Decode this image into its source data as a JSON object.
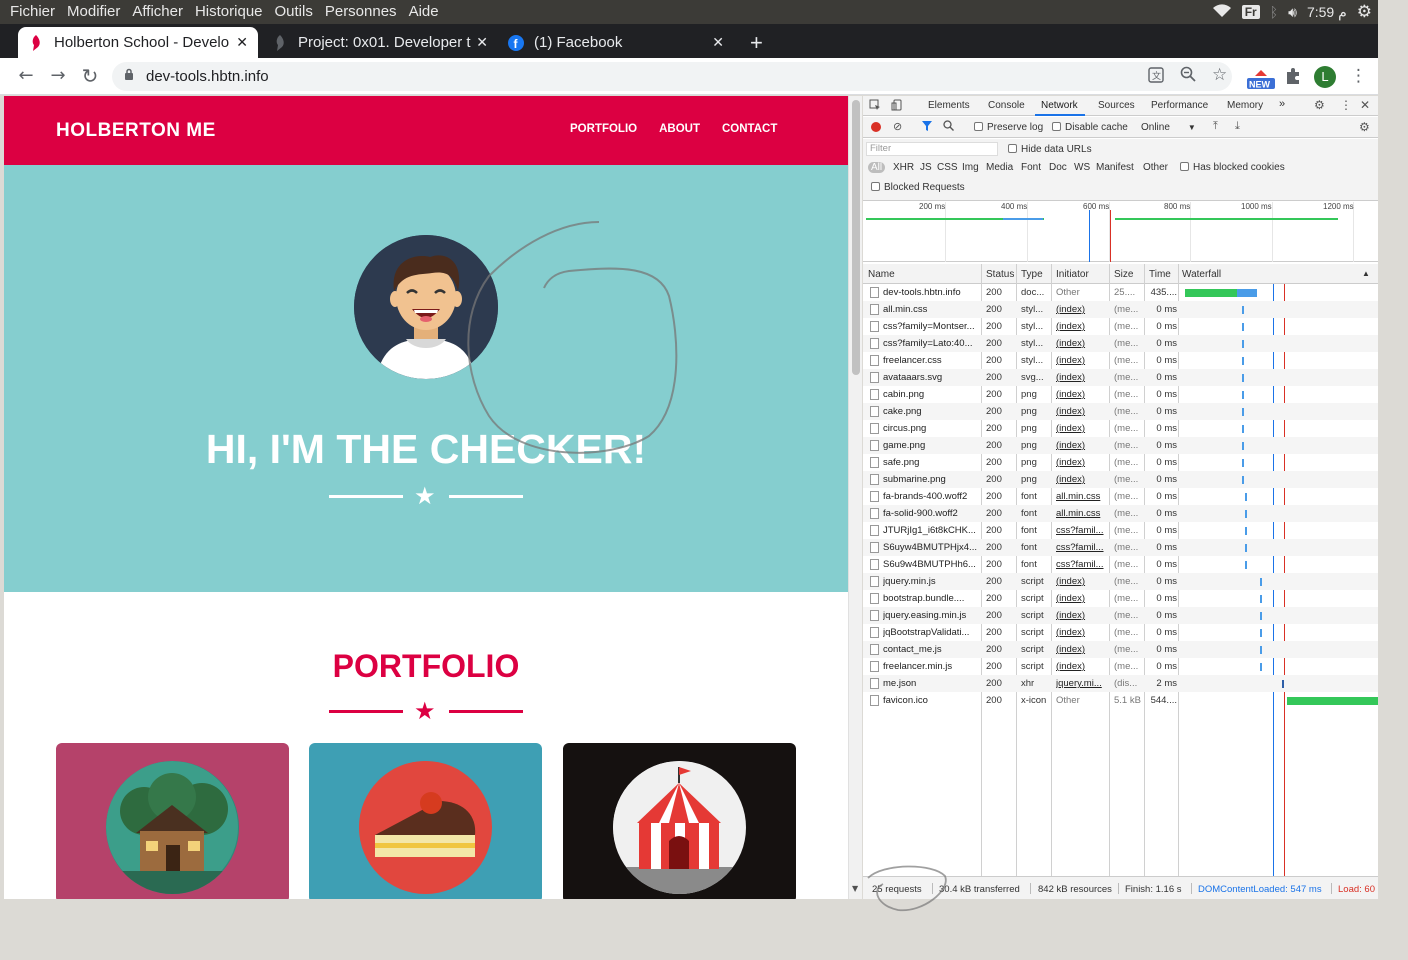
{
  "system_bar": {
    "menu": [
      "Fichier",
      "Modifier",
      "Afficher",
      "Historique",
      "Outils",
      "Personnes",
      "Aide"
    ],
    "keyboard": "Fr",
    "clock": "م 7:59"
  },
  "tabs": [
    {
      "title": "Holberton School - Develo",
      "active": true
    },
    {
      "title": "Project: 0x01. Developer t",
      "active": false
    },
    {
      "title": "(1) Facebook",
      "active": false
    }
  ],
  "address": {
    "url": "dev-tools.hbtn.info",
    "extension_badge": "NEW",
    "profile_initial": "L"
  },
  "site": {
    "brand": "HOLBERTON ME",
    "nav": [
      "PORTFOLIO",
      "ABOUT",
      "CONTACT"
    ],
    "hero_title": "HI, I'M THE CHECKER!",
    "portfolio_title": "PORTFOLIO",
    "colors": {
      "primary": "#dc0042",
      "hero": "#85cecf",
      "card1": "#b5426a",
      "card2": "#3e9fb4",
      "card3": "#151110"
    }
  },
  "devtools": {
    "tabs": [
      "Elements",
      "Console",
      "Network",
      "Sources",
      "Performance",
      "Memory",
      "»"
    ],
    "active_tab": "Network",
    "controls": {
      "preserve_log": "Preserve log",
      "disable_cache": "Disable cache",
      "throttle": "Online"
    },
    "filter": {
      "placeholder": "Filter",
      "hide_data_urls": "Hide data URLs",
      "types": [
        "All",
        "XHR",
        "JS",
        "CSS",
        "Img",
        "Media",
        "Font",
        "Doc",
        "WS",
        "Manifest",
        "Other"
      ],
      "has_blocked_cookies": "Has blocked cookies",
      "blocked_requests": "Blocked Requests"
    },
    "timeline_ticks": [
      "200 ms",
      "400 ms",
      "600 ms",
      "800 ms",
      "1000 ms",
      "1200 ms"
    ],
    "columns": [
      "Name",
      "Status",
      "Type",
      "Initiator",
      "Size",
      "Time",
      "Waterfall"
    ],
    "rows": [
      {
        "name": "dev-tools.hbtn.info",
        "status": "200",
        "type": "doc...",
        "initiator": "Other",
        "size": "25....",
        "time": "435...."
      },
      {
        "name": "all.min.css",
        "status": "200",
        "type": "styl...",
        "initiator": "(index)",
        "size": "(me...",
        "time": "0 ms"
      },
      {
        "name": "css?family=Montser...",
        "status": "200",
        "type": "styl...",
        "initiator": "(index)",
        "size": "(me...",
        "time": "0 ms"
      },
      {
        "name": "css?family=Lato:40...",
        "status": "200",
        "type": "styl...",
        "initiator": "(index)",
        "size": "(me...",
        "time": "0 ms"
      },
      {
        "name": "freelancer.css",
        "status": "200",
        "type": "styl...",
        "initiator": "(index)",
        "size": "(me...",
        "time": "0 ms"
      },
      {
        "name": "avataaars.svg",
        "status": "200",
        "type": "svg...",
        "initiator": "(index)",
        "size": "(me...",
        "time": "0 ms"
      },
      {
        "name": "cabin.png",
        "status": "200",
        "type": "png",
        "initiator": "(index)",
        "size": "(me...",
        "time": "0 ms"
      },
      {
        "name": "cake.png",
        "status": "200",
        "type": "png",
        "initiator": "(index)",
        "size": "(me...",
        "time": "0 ms"
      },
      {
        "name": "circus.png",
        "status": "200",
        "type": "png",
        "initiator": "(index)",
        "size": "(me...",
        "time": "0 ms"
      },
      {
        "name": "game.png",
        "status": "200",
        "type": "png",
        "initiator": "(index)",
        "size": "(me...",
        "time": "0 ms"
      },
      {
        "name": "safe.png",
        "status": "200",
        "type": "png",
        "initiator": "(index)",
        "size": "(me...",
        "time": "0 ms"
      },
      {
        "name": "submarine.png",
        "status": "200",
        "type": "png",
        "initiator": "(index)",
        "size": "(me...",
        "time": "0 ms"
      },
      {
        "name": "fa-brands-400.woff2",
        "status": "200",
        "type": "font",
        "initiator": "all.min.css",
        "size": "(me...",
        "time": "0 ms"
      },
      {
        "name": "fa-solid-900.woff2",
        "status": "200",
        "type": "font",
        "initiator": "all.min.css",
        "size": "(me...",
        "time": "0 ms"
      },
      {
        "name": "JTURjIg1_i6t8kCHK...",
        "status": "200",
        "type": "font",
        "initiator": "css?famil...",
        "size": "(me...",
        "time": "0 ms"
      },
      {
        "name": "S6uyw4BMUTPHjx4...",
        "status": "200",
        "type": "font",
        "initiator": "css?famil...",
        "size": "(me...",
        "time": "0 ms"
      },
      {
        "name": "S6u9w4BMUTPHh6...",
        "status": "200",
        "type": "font",
        "initiator": "css?famil...",
        "size": "(me...",
        "time": "0 ms"
      },
      {
        "name": "jquery.min.js",
        "status": "200",
        "type": "script",
        "initiator": "(index)",
        "size": "(me...",
        "time": "0 ms"
      },
      {
        "name": "bootstrap.bundle....",
        "status": "200",
        "type": "script",
        "initiator": "(index)",
        "size": "(me...",
        "time": "0 ms"
      },
      {
        "name": "jquery.easing.min.js",
        "status": "200",
        "type": "script",
        "initiator": "(index)",
        "size": "(me...",
        "time": "0 ms"
      },
      {
        "name": "jqBootstrapValidati...",
        "status": "200",
        "type": "script",
        "initiator": "(index)",
        "size": "(me...",
        "time": "0 ms"
      },
      {
        "name": "contact_me.js",
        "status": "200",
        "type": "script",
        "initiator": "(index)",
        "size": "(me...",
        "time": "0 ms"
      },
      {
        "name": "freelancer.min.js",
        "status": "200",
        "type": "script",
        "initiator": "(index)",
        "size": "(me...",
        "time": "0 ms"
      },
      {
        "name": "me.json",
        "status": "200",
        "type": "xhr",
        "initiator": "jquery.mi...",
        "size": "(dis...",
        "time": "2 ms"
      },
      {
        "name": "favicon.ico",
        "status": "200",
        "type": "x-icon",
        "initiator": "Other",
        "size": "5.1 kB",
        "time": "544...."
      }
    ],
    "status_bar": {
      "requests": "25 requests",
      "transferred": "30.4 kB transferred",
      "resources": "842 kB resources",
      "finish": "Finish: 1.16 s",
      "dom_loaded": "DOMContentLoaded: 547 ms",
      "load": "Load: 60"
    }
  }
}
